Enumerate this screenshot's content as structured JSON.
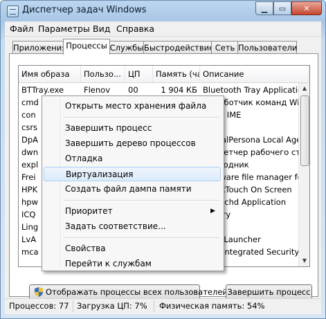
{
  "window": {
    "title": "Диспетчер задач Windows"
  },
  "menu": [
    "Файл",
    "Параметры",
    "Вид",
    "Справка"
  ],
  "tabs": [
    "Приложения",
    "Процессы",
    "Службы",
    "Быстродействие",
    "Сеть",
    "Пользователи"
  ],
  "active_tab": "Процессы",
  "columns": [
    "Имя образа",
    "Пользо...",
    "ЦП",
    "Память (ча...",
    "Описание"
  ],
  "rows": [
    {
      "name": "BTTray.exe",
      "user": "Flenov",
      "cpu": "00",
      "mem": "1 904 КБ",
      "desc": "Bluetooth Tray Application"
    },
    {
      "name": "cmd",
      "user": "",
      "cpu": "",
      "mem": "",
      "desc": "Обработчик команд Windows"
    },
    {
      "name": "con",
      "user": "",
      "cpu": "",
      "mem": "",
      "desc": "Sonic IME"
    },
    {
      "name": "csrs",
      "user": "",
      "cpu": "",
      "mem": "",
      "desc": ""
    },
    {
      "name": "DpA",
      "user": "",
      "cpu": "",
      "mem": "",
      "desc": "DigitalPersona Local Agent"
    },
    {
      "name": "dwn",
      "user": "",
      "cpu": "",
      "mem": "",
      "desc": "Диспетчер рабочего стола"
    },
    {
      "name": "expl",
      "user": "",
      "cpu": "",
      "mem": "",
      "desc": "Проводник"
    },
    {
      "name": "Frei",
      "user": "",
      "cpu": "",
      "mem": "",
      "desc": "Freeware file manager for"
    },
    {
      "name": "HPK",
      "user": "",
      "cpu": "",
      "mem": "",
      "desc": "QuickTouch On Screen"
    },
    {
      "name": "hpw",
      "user": "",
      "cpu": "",
      "mem": "",
      "desc": "hpwSchd Application"
    },
    {
      "name": "ICQ",
      "user": "",
      "cpu": "",
      "mem": "",
      "desc": "Library"
    },
    {
      "name": "Ling",
      "user": "",
      "cpu": "",
      "mem": "",
      "desc": ""
    },
    {
      "name": "LvA",
      "user": "",
      "cpu": "",
      "mem": "",
      "desc": "Auto Launcher"
    },
    {
      "name": "mca",
      "user": "",
      "cpu": "",
      "mem": "",
      "desc": "Free Integrated Security"
    }
  ],
  "context_menu": {
    "items": [
      {
        "label": "Открыть место хранения файла"
      },
      {
        "sep": true
      },
      {
        "label": "Завершить процесс"
      },
      {
        "label": "Завершить дерево процессов"
      },
      {
        "label": "Отладка"
      },
      {
        "label": "Виртуализация",
        "highlight": true
      },
      {
        "label": "Создать файл дампа памяти"
      },
      {
        "sep": true
      },
      {
        "label": "Приоритет",
        "submenu": true
      },
      {
        "label": "Задать соответствие..."
      },
      {
        "sep": true
      },
      {
        "label": "Свойства"
      },
      {
        "label": "Перейти к службам"
      }
    ]
  },
  "buttons": {
    "show_all": "Отображать процессы всех пользователей",
    "end_process": "Завершить процесс"
  },
  "status": {
    "processes": "Процессов: 77",
    "cpu": "Загрузка ЦП: 7%",
    "memory": "Физическая память: 54%"
  }
}
